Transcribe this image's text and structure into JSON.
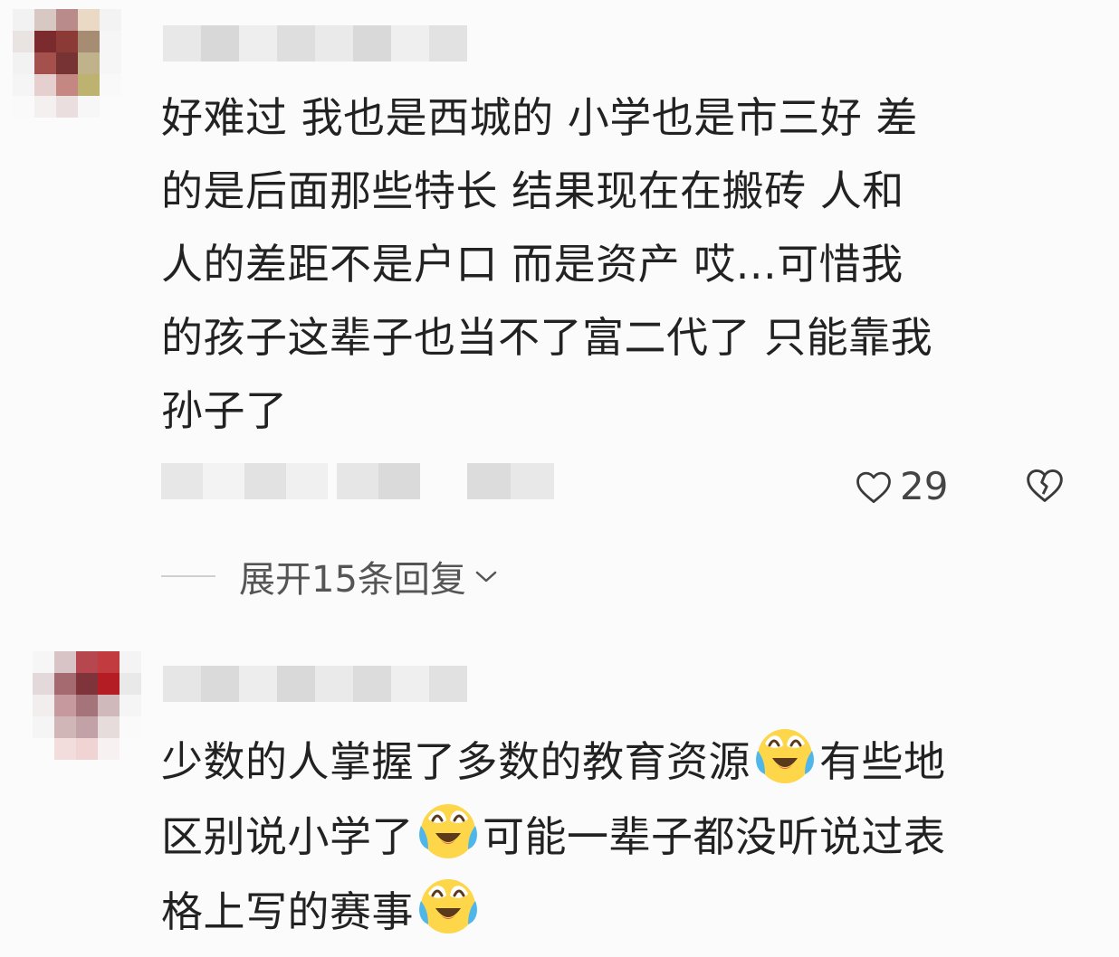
{
  "comments": [
    {
      "text": "好难过 我也是西城的 小学也是市三好 差\n的是后面那些特长 结果现在在搬砖 人和\n人的差距不是户口 而是资产 哎...可惜我\n的孩子这辈子也当不了富二代了 只能靠我\n孙子了",
      "likes": "29",
      "expand_replies": "展开15条回复"
    },
    {
      "segments": [
        "少数的人掌握了多数的教育资源",
        "有些地\n区别说小学了",
        "可能一辈子都没听说过表\n格上写的赛事"
      ],
      "emoji": "crying-laughing-emoji"
    }
  ],
  "icons": {
    "like": "heart-outline-icon",
    "dislike": "broken-heart-icon",
    "expand": "chevron-down-icon"
  },
  "colors": {
    "background": "#fbfbfb",
    "text": "#222222",
    "muted": "#555555"
  }
}
